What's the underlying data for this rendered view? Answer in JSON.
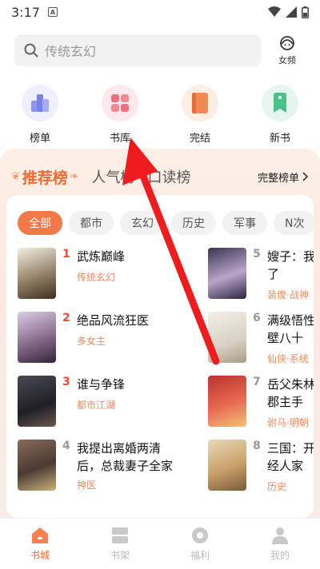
{
  "status": {
    "time": "3:17"
  },
  "search": {
    "placeholder": "传统玄幻",
    "gender_label": "女频"
  },
  "quick_nav": [
    {
      "label": "榜单",
      "color": "#8e94f2",
      "bg": "#eef0fd"
    },
    {
      "label": "书库",
      "color": "#f07080",
      "bg": "#fde9ec"
    },
    {
      "label": "完结",
      "color": "#f28a55",
      "bg": "#fdeee5"
    },
    {
      "label": "新书",
      "color": "#4cbf8a",
      "bg": "#e6f6ee"
    }
  ],
  "rank": {
    "active_tab": "推荐榜",
    "tabs": [
      "人气榜",
      "口读榜"
    ],
    "more_label": "完整榜单",
    "chips": [
      "全部",
      "都市",
      "玄幻",
      "历史",
      "军事",
      "N次"
    ],
    "books_left": [
      {
        "no": "1",
        "title": "武炼巅峰",
        "tag": "传统玄幻"
      },
      {
        "no": "2",
        "title": "绝品风流狂医",
        "tag": "多女主"
      },
      {
        "no": "3",
        "title": "谁与争锋",
        "tag": "都市江湖"
      },
      {
        "no": "4",
        "title": "我提出离婚两清后，总裁妻子全家",
        "tag": "神医"
      }
    ],
    "books_right": [
      {
        "no": "5",
        "title": "嫂子：我子了",
        "tag": "装傻·战神"
      },
      {
        "no": "6",
        "title": "满级悟性面壁八十",
        "tag": "仙侠·系统"
      },
      {
        "no": "7",
        "title": "岳父朱林容郡主手",
        "tag": "驸马·明朝"
      },
      {
        "no": "8",
        "title": "三国：开正经人家",
        "tag": "历史"
      }
    ]
  },
  "tab_bar": [
    {
      "label": "书城",
      "active": true
    },
    {
      "label": "书架",
      "active": false
    },
    {
      "label": "福利",
      "active": false
    },
    {
      "label": "我的",
      "active": false
    }
  ]
}
